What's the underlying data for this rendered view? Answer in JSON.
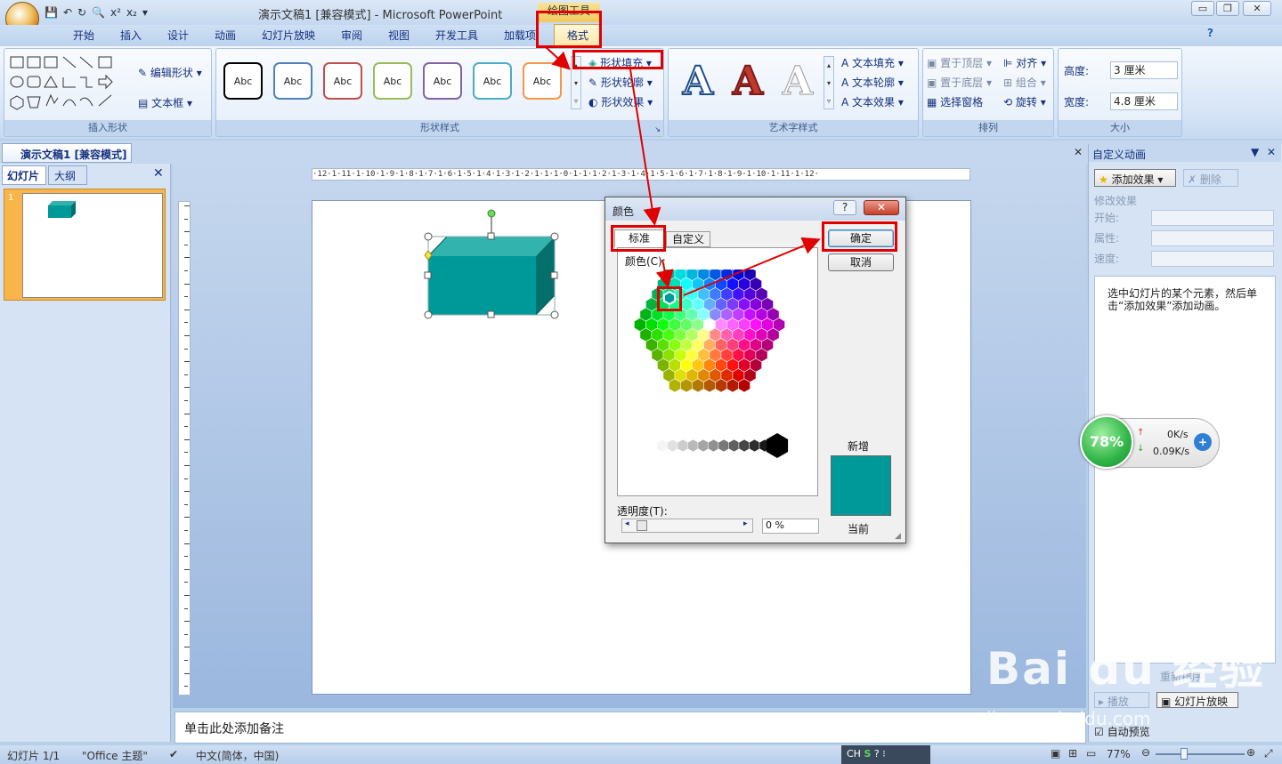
{
  "window": {
    "title": "演示文稿1 [兼容模式] - Microsoft PowerPoint",
    "context_tool": "绘图工具",
    "min": "▭",
    "max": "❐",
    "close": "✕"
  },
  "qat": {
    "items": [
      "💾",
      "↶",
      "↻",
      "🔍",
      "x²",
      "x₂",
      "▾"
    ]
  },
  "tabs": [
    "开始",
    "插入",
    "设计",
    "动画",
    "幻灯片放映",
    "审阅",
    "视图",
    "开发工具",
    "加载项"
  ],
  "active_tab": "格式",
  "ribbon": {
    "groups": {
      "insert_shapes": "插入形状",
      "shape_styles": "形状样式",
      "wordart_styles": "艺术字样式",
      "arrange": "排列",
      "size": "大小"
    },
    "edit_shape": "编辑形状",
    "text_box": "文本框",
    "style_boxes": [
      {
        "label": "Abc",
        "color": "#000000"
      },
      {
        "label": "Abc",
        "color": "#4f81bd"
      },
      {
        "label": "Abc",
        "color": "#c0504d"
      },
      {
        "label": "Abc",
        "color": "#9bbb59"
      },
      {
        "label": "Abc",
        "color": "#8064a2"
      },
      {
        "label": "Abc",
        "color": "#4bacc6"
      },
      {
        "label": "Abc",
        "color": "#f79646"
      }
    ],
    "shape_fill": "形状填充",
    "shape_outline": "形状轮廓",
    "shape_effects": "形状效果",
    "wordart_letter": "A",
    "text_fill": "文本填充",
    "text_outline": "文本轮廓",
    "text_effects": "文本效果",
    "bring_front": "置于顶层",
    "send_back": "置于底层",
    "selection_pane": "选择窗格",
    "align": "对齐",
    "group": "组合",
    "rotate": "旋转",
    "height_label": "高度:",
    "height_value": "3 厘米",
    "width_label": "宽度:",
    "width_value": "4.8 厘米"
  },
  "document_tab": "演示文稿1 [兼容模式]",
  "left_pane": {
    "tab_slides": "幻灯片",
    "tab_outline": "大纲",
    "slide_number": "1"
  },
  "ruler_text": "·12·1·11·1·10·1·9·1·8·1·7·1·6·1·5·1·4·1·3·1·2·1·1·1·0·1·1·1·2·1·3·1·4·1·5·1·6·1·7·1·8·1·9·1·10·1·11·1·12·",
  "notes_placeholder": "单击此处添加备注",
  "dialog": {
    "title": "颜色",
    "tab_standard": "标准",
    "tab_custom": "自定义",
    "colors_label": "颜色(C):",
    "transparency_label": "透明度(T):",
    "transparency_value": "0 %",
    "ok": "确定",
    "cancel": "取消",
    "new_label": "新增",
    "current_label": "当前",
    "new_color": "#009999"
  },
  "right_pane": {
    "title": "自定义动画",
    "add_effect": "添加效果",
    "delete": "删除",
    "modify": "修改效果",
    "start": "开始:",
    "property": "属性:",
    "speed": "速度:",
    "hint": "选中幻灯片的某个元素，然后单击“添加效果”添加动画。",
    "reorder": "重新排序",
    "play": "播放",
    "slideshow": "幻灯片放映",
    "autopreview": "自动预览"
  },
  "net_widget": {
    "percent": "78%",
    "up": "0K/s",
    "down": "0.09K/s"
  },
  "status": {
    "slide": "幻灯片 1/1",
    "theme": "\"Office 主题\"",
    "lang": "中文(简体，中国)",
    "ime": "CH",
    "zoom": "77%"
  },
  "watermark": {
    "brand": "Bai du 经验",
    "url": "jingyan.baidu.com"
  }
}
